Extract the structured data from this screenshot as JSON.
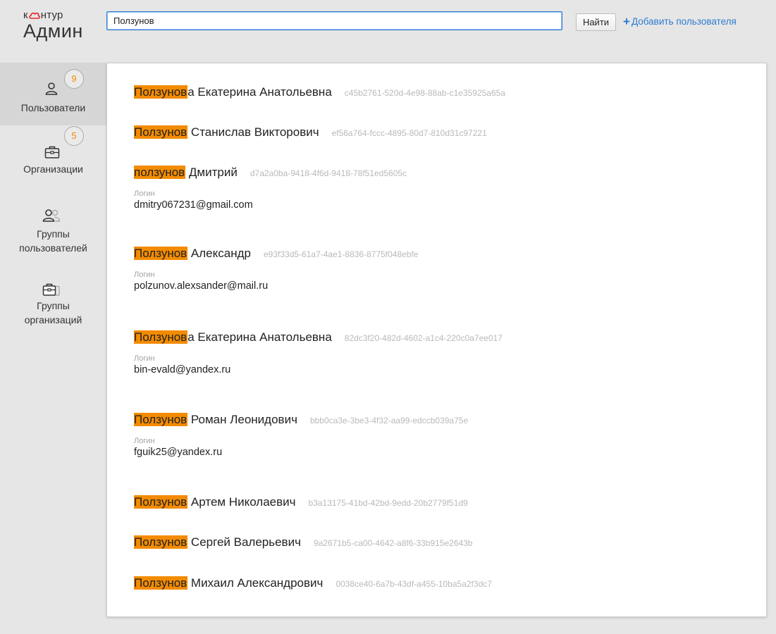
{
  "logo": {
    "top": "к",
    "top_rest": "нтур",
    "bottom": "Админ"
  },
  "search": {
    "value": "Ползунов",
    "button": "Найти"
  },
  "add_user": {
    "icon": "plus-icon",
    "label": "Добавить пользователя"
  },
  "sidebar": {
    "items": [
      {
        "icon": "user-icon",
        "label": "Пользователи",
        "badge": "9",
        "active": true
      },
      {
        "icon": "briefcase-icon",
        "label": "Организации",
        "badge": "5",
        "active": false
      },
      {
        "icon": "users-group-icon",
        "label_line1": "Группы",
        "label_line2": "пользователей",
        "active": false
      },
      {
        "icon": "briefcases-group-icon",
        "label_line1": "Группы",
        "label_line2": "организаций",
        "active": false
      }
    ]
  },
  "results": [
    {
      "highlight": "Ползунов",
      "rest": "а Екатерина Анатольевна",
      "id": "c45b2761-520d-4e98-88ab-c1e35925a65a"
    },
    {
      "highlight": "Ползунов",
      "rest": " Станислав Викторович",
      "id": "ef56a764-fccc-4895-80d7-810d31c97221"
    },
    {
      "highlight": "ползунов",
      "rest": " Дмитрий",
      "id": "d7a2a0ba-9418-4f6d-9418-78f51ed5605c",
      "login_label": "Логин",
      "login": "dmitry067231@gmail.com"
    },
    {
      "highlight": "Ползунов",
      "rest": " Александр",
      "id": "e93f33d5-61a7-4ae1-8836-8775f048ebfe",
      "login_label": "Логин",
      "login": "polzunov.alexsander@mail.ru"
    },
    {
      "highlight": "Ползунов",
      "rest": "а Екатерина Анатольевна",
      "id": "82dc3f20-482d-4602-a1c4-220c0a7ee017",
      "login_label": "Логин",
      "login": "bin-evald@yandex.ru"
    },
    {
      "highlight": "Ползунов",
      "rest": " Роман Леонидович",
      "id": "bbb0ca3e-3be3-4f32-aa99-edccb039a75e",
      "login_label": "Логин",
      "login": "fguik25@yandex.ru"
    },
    {
      "highlight": "Ползунов",
      "rest": " Артем Николаевич",
      "id": "b3a13175-41bd-42bd-9edd-20b2779f51d9"
    },
    {
      "highlight": "Ползунов",
      "rest": " Сергей Валерьевич",
      "id": "9a2671b5-ca00-4642-a8f6-33b915e2643b"
    },
    {
      "highlight": "Ползунов",
      "rest": " Михаил Александрович",
      "id": "0038ce40-6a7b-43df-a455-10ba5a2f3dc7"
    }
  ],
  "colors": {
    "highlight": "#f38b00",
    "link": "#2d7bd0",
    "badge_text": "#f38b00",
    "logo_accent": "#e8262d"
  }
}
